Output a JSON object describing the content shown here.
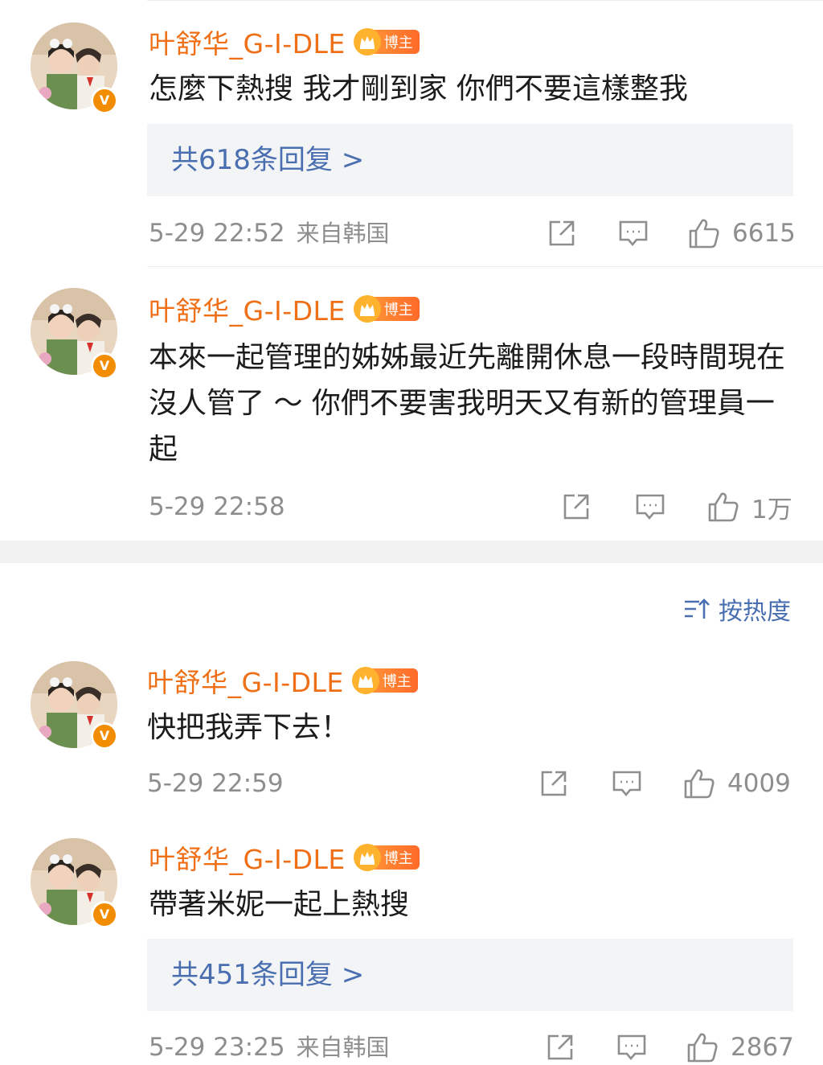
{
  "comments": [
    {
      "username": "叶舒华_G-I-DLE",
      "badge": "博主",
      "text": "怎麼下熱搜 我才剛到家 你們不要這樣整我",
      "replies_label": "共618条回复 >",
      "time": "5-29 22:52",
      "source": "来自韩国",
      "likes": "6615"
    },
    {
      "username": "叶舒华_G-I-DLE",
      "badge": "博主",
      "text": "本來一起管理的姊姊最近先離開休息一段時間現在沒人管了 ～ 你們不要害我明天又有新的管理員一起",
      "replies_label": "",
      "time": "5-29 22:58",
      "source": "",
      "likes": "1万"
    },
    {
      "username": "叶舒华_G-I-DLE",
      "badge": "博主",
      "text": "快把我弄下去！",
      "replies_label": "",
      "time": "5-29 22:59",
      "source": "",
      "likes": "4009"
    },
    {
      "username": "叶舒华_G-I-DLE",
      "badge": "博主",
      "text": "帶著米妮一起上熱搜",
      "replies_label": "共451条回复 >",
      "time": "5-29 23:25",
      "source": "来自韩国",
      "likes": "2867"
    }
  ],
  "sort": {
    "label": "按热度",
    "icon": "sort-icon"
  },
  "icons": {
    "share": "share-icon",
    "comment": "comment-icon",
    "like": "like-icon",
    "verified": "verified-badge"
  },
  "colors": {
    "username": "#ef6f16",
    "link": "#4a6fb0",
    "meta": "#8e8e8e",
    "badge": "#ff7a2a"
  }
}
